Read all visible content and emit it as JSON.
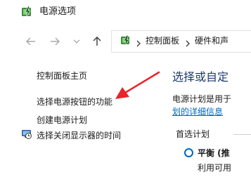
{
  "window": {
    "title": "电源选项",
    "icon": "power-options-icon"
  },
  "nav": {
    "back_icon": "arrow-left-icon",
    "forward_icon": "arrow-right-icon",
    "recent_icon": "chevron-down-icon",
    "up_icon": "arrow-up-icon"
  },
  "address": {
    "icon": "control-panel-icon",
    "crumbs": [
      "控制面板",
      "硬件和声"
    ]
  },
  "sidebar": {
    "items": [
      {
        "label": "控制面板主页"
      },
      {
        "label": "选择电源按钮的功能"
      },
      {
        "label": "创建电源计划"
      },
      {
        "label": "选择关闭显示器的时间"
      }
    ]
  },
  "annotation": {
    "color": "#e8242a"
  },
  "main": {
    "heading": "选择或自定",
    "text": "电源计划是用于",
    "link": "划的详细信息",
    "section_label": "首选计划",
    "plan": {
      "name": "平衡 (推",
      "desc": "利用可用"
    }
  },
  "colors": {
    "accent": "#0067c0",
    "heading": "#1f3b6e"
  }
}
